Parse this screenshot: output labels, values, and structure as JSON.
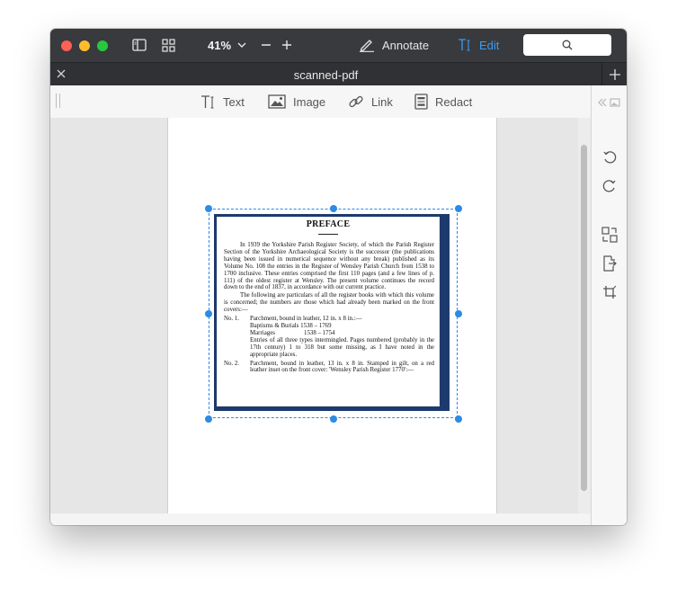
{
  "toolbar": {
    "zoom": "41%",
    "annotate_label": "Annotate",
    "edit_label": "Edit",
    "accent_color": "#3d9bf0"
  },
  "tab": {
    "title": "scanned-pdf"
  },
  "edit_tools": [
    {
      "label": "Text",
      "icon": "text-tool-icon"
    },
    {
      "label": "Image",
      "icon": "image-tool-icon"
    },
    {
      "label": "Link",
      "icon": "link-tool-icon"
    },
    {
      "label": "Redact",
      "icon": "redact-tool-icon"
    }
  ],
  "sidebar_icons": [
    "collapse-icon",
    "image-thumb-icon",
    "rotate-left-icon",
    "rotate-right-icon",
    "replace-image-icon",
    "extract-image-icon",
    "crop-icon"
  ],
  "scan": {
    "title": "PREFACE",
    "para1": "In 1939 the Yorkshire Parish Register Society, of which the Parish Register Section of the Yorkshire Archaeological Society is the successor (the publications having been issued in numerical sequence without any break) published as its Volume No. 108 the entries in the Register of Wensley Parish Church from 1538 to 1700 inclusive. These entries comprised the first 110 pages (and a few lines of p. 111) of the oldest register at Wensley. The present volume continues the record down to the end of 1837, in accordance with our current practice.",
    "para2": "The following are particulars of all the register books with which this volume is concerned; the numbers are those which had already been marked on the front covers:—",
    "entry1_num": "No. 1.",
    "entry1_line1": "Parchment, bound in leather, 12 in. x 8 in.:—",
    "entry1_line2": "Baptisms & Burials 1538 – 1769",
    "entry1_marriages_label": "Marriages",
    "entry1_marriages_years": "1538 – 1754",
    "entry1_line4": "Entries of all three types intermingled. Pages numbered (probably in the 17th century) 1 to 318 but some missing, as I have noted in the appropriate places.",
    "entry2_num": "No. 2.",
    "entry2_text": "Parchment, bound in leather, 13 in. x 8 in. Stamped in gilt, on a red leather inset on the front cover: 'Wensley Parish Register 1770':—"
  }
}
